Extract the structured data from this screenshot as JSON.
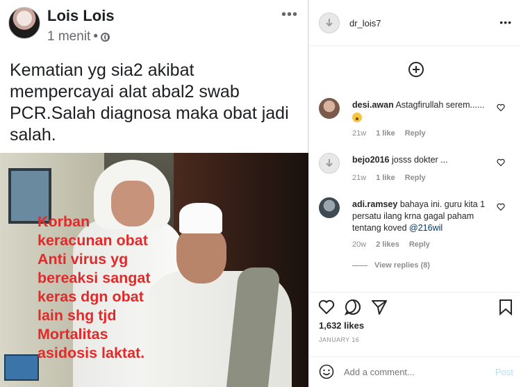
{
  "facebook": {
    "author": "Lois Lois",
    "time": "1 menit",
    "separator": "•",
    "more": "•••",
    "text": "Kematian yg sia2 akibat mempercayai alat abal2 swab PCR.Salah diagnosa maka obat jadi salah.",
    "image_overlay_lines": [
      "Korban",
      "keracunan obat",
      "Anti virus yg",
      "bereaksi sangat",
      "keras dgn obat",
      "lain shg tjd",
      "Mortalitas",
      "asidosis laktat."
    ],
    "overlay_color": "#e22a2a"
  },
  "instagram": {
    "username": "dr_lois7",
    "more": "•••",
    "comments": [
      {
        "user": "desi.awan",
        "text": "Astagfirullah serem......",
        "age": "21w",
        "likes": "1 like",
        "reply": "Reply"
      },
      {
        "user": "bejo2016",
        "text": "josss dokter ...",
        "age": "21w",
        "likes": "1 like",
        "reply": "Reply"
      },
      {
        "user": "adi.ramsey",
        "text": "bahaya ini. guru kita 1 persatu ilang krna gagal paham tentang koved",
        "mention": "@216wil",
        "age": "20w",
        "likes": "2 likes",
        "reply": "Reply"
      }
    ],
    "view_replies": "View replies (8)",
    "likes": "1,632 likes",
    "date": "JANUARY 16",
    "add_comment_placeholder": "Add a comment...",
    "post_label": "Post",
    "colors": {
      "link": "#00376b",
      "muted": "#8e8e8e",
      "post_disabled": "#b2dffc"
    }
  }
}
